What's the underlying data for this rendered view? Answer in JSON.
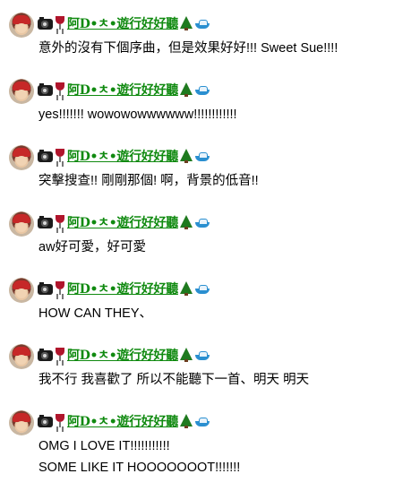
{
  "comments": [
    {
      "username": "阿D•ㅊ•遊行好好聽",
      "lines": [
        "意外的沒有下個序曲，但是效果好好!!! Sweet Sue!!!!"
      ]
    },
    {
      "username": "阿D•ㅊ•遊行好好聽",
      "lines": [
        "yes!!!!!!! wowowowwwwww!!!!!!!!!!!!"
      ]
    },
    {
      "username": "阿D•ㅊ•遊行好好聽",
      "lines": [
        "突擊搜查!! 剛剛那個! 啊，背景的低音!!"
      ]
    },
    {
      "username": "阿D•ㅊ•遊行好好聽",
      "lines": [
        "aw好可愛，好可愛"
      ]
    },
    {
      "username": "阿D•ㅊ•遊行好好聽",
      "lines": [
        "HOW CAN THEY、"
      ]
    },
    {
      "username": "阿D•ㅊ•遊行好好聽",
      "lines": [
        "我不行 我喜歡了 所以不能聽下一首、明天 明天"
      ]
    },
    {
      "username": "阿D•ㅊ•遊行好好聽",
      "lines": [
        "OMG I LOVE IT!!!!!!!!!!!",
        "SOME LIKE IT HOOOOOOOT!!!!!!!"
      ]
    }
  ],
  "icons": {
    "before_name": [
      "camera-icon",
      "wine-glass-icon"
    ],
    "after_name": [
      "tree-icon",
      "boat-icon"
    ]
  },
  "colors": {
    "username": "#108a10",
    "text": "#000000",
    "background": "#ffffff"
  }
}
